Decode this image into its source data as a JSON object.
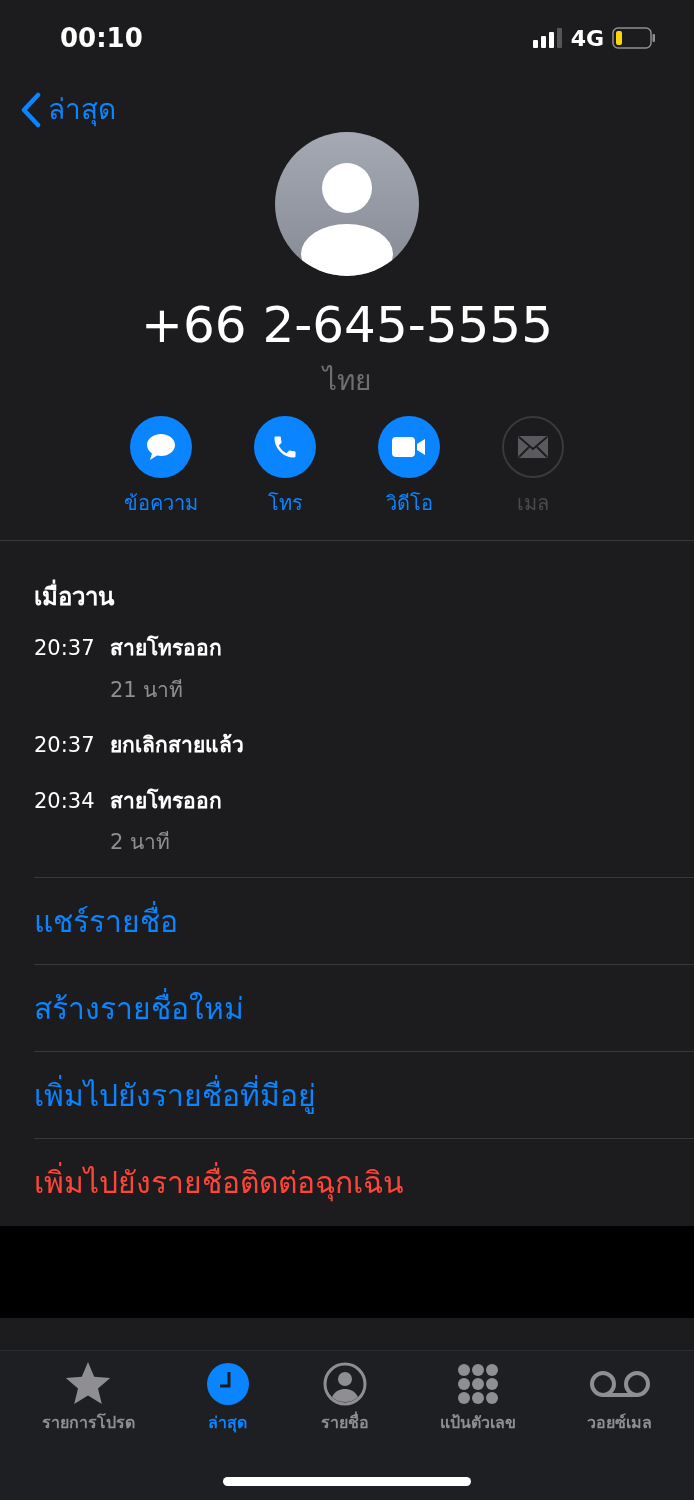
{
  "status_bar": {
    "time": "00:10",
    "network": "4G"
  },
  "nav": {
    "back_label": "ล่าสุด"
  },
  "contact": {
    "number": "+66 2-645-5555",
    "country": "ไทย"
  },
  "actions": [
    {
      "kind": "message",
      "label": "ข้อความ",
      "disabled": false
    },
    {
      "kind": "call",
      "label": "โทร",
      "disabled": false
    },
    {
      "kind": "video",
      "label": "วิดีโอ",
      "disabled": false
    },
    {
      "kind": "mail",
      "label": "เมล",
      "disabled": true
    }
  ],
  "history": {
    "date": "เมื่อวาน",
    "calls": [
      {
        "time": "20:37",
        "type": "สายโทรออก",
        "duration": "21 นาที"
      },
      {
        "time": "20:37",
        "type": "ยกเลิกสายแล้ว"
      },
      {
        "time": "20:34",
        "type": "สายโทรออก",
        "duration": "2 นาที"
      }
    ]
  },
  "options": [
    {
      "label": "แชร์รายชื่อ",
      "kind": "normal"
    },
    {
      "label": "สร้างรายชื่อใหม่",
      "kind": "normal"
    },
    {
      "label": "เพิ่มไปยังรายชื่อที่มีอยู่",
      "kind": "normal"
    },
    {
      "label": "เพิ่มไปยังรายชื่อติดต่อฉุกเฉิน",
      "kind": "destructive"
    }
  ],
  "tab_bar": [
    {
      "kind": "favorites",
      "label": "รายการโปรด",
      "selected": false
    },
    {
      "kind": "recents",
      "label": "ล่าสุด",
      "selected": true
    },
    {
      "kind": "contacts",
      "label": "รายชื่อ",
      "selected": false
    },
    {
      "kind": "keypad",
      "label": "แป้นตัวเลข",
      "selected": false
    },
    {
      "kind": "voicemail",
      "label": "วอยซ์เมล",
      "selected": false
    }
  ]
}
